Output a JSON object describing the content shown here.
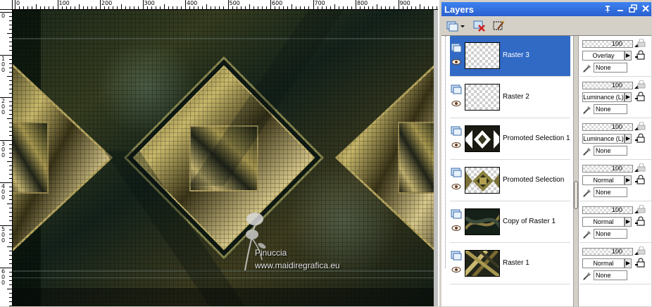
{
  "canvas": {
    "ruler_top_labels": [
      "0",
      "100",
      "200",
      "300",
      "400",
      "500",
      "600",
      "700",
      "800",
      "900",
      "1000"
    ],
    "ruler_left_labels": [
      "0",
      "100",
      "200",
      "300",
      "400",
      "500",
      "600"
    ],
    "watermark_name": "Pinuccia",
    "watermark_url": "www.maidiregrafica.eu"
  },
  "layers_panel": {
    "title": "Layers",
    "layers": [
      {
        "name": "Raster 3",
        "opacity": "100",
        "blend": "Overlay",
        "mask": "None",
        "selected": true,
        "thumb": "transparent"
      },
      {
        "name": "Raster 2",
        "opacity": "100",
        "blend": "Luminance (L)",
        "mask": "None",
        "selected": false,
        "thumb": "transparent"
      },
      {
        "name": "Promoted Selection 1",
        "opacity": "100",
        "blend": "Luminance (L)",
        "mask": "None",
        "selected": false,
        "thumb": "diamonds-white"
      },
      {
        "name": "Promoted Selection",
        "opacity": "100",
        "blend": "Normal",
        "mask": "None",
        "selected": false,
        "thumb": "diamonds-gold"
      },
      {
        "name": "Copy of Raster 1",
        "opacity": "100",
        "blend": "Normal",
        "mask": "None",
        "selected": false,
        "thumb": "dark-swirl"
      },
      {
        "name": "Raster 1",
        "opacity": "100",
        "blend": "Normal",
        "mask": "None",
        "selected": false,
        "thumb": "gold-weave"
      }
    ]
  }
}
